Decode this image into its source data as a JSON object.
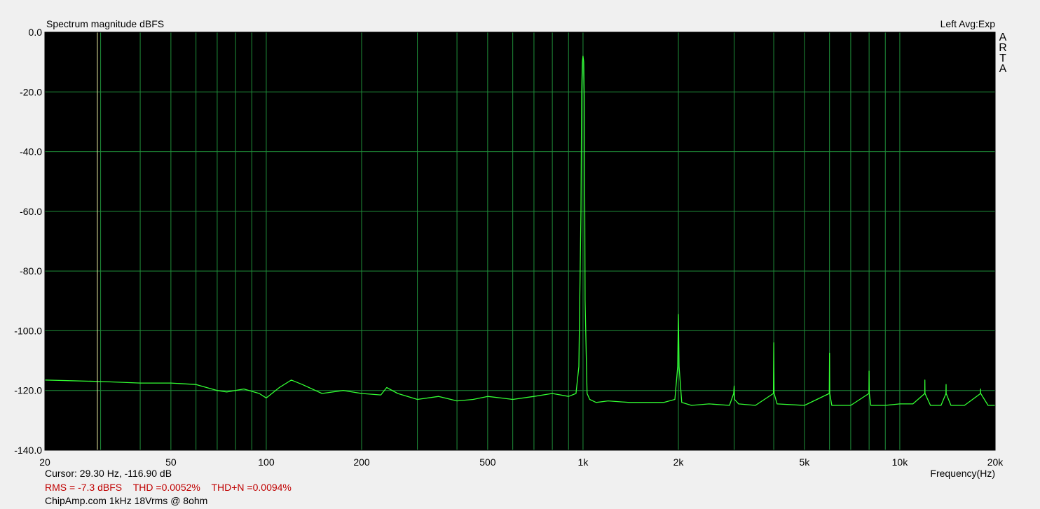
{
  "header": {
    "title": "Spectrum magnitude dBFS",
    "right_info": "Left  Avg:Exp",
    "brand_letters": [
      "A",
      "R",
      "T",
      "A"
    ]
  },
  "footer": {
    "cursor": "Cursor: 29.30 Hz, -116.90 dB",
    "xlabel": "Frequency(Hz)",
    "rms": "RMS =   -7.3 dBFS",
    "thd": "THD =0.0052%",
    "thdn": "THD+N =0.0094%",
    "caption": "ChipAmp.com 1kHz 18Vrms @ 8ohm"
  },
  "colors": {
    "plot_background": "#000000",
    "grid": "#1f8f3a",
    "trace": "#33ff33",
    "cursor": "#e8e8a0",
    "stats_text": "#c00000"
  },
  "chart_data": {
    "type": "line",
    "title": "Spectrum magnitude dBFS",
    "xlabel": "Frequency(Hz)",
    "ylabel": "",
    "x_scale": "log",
    "xlim": [
      20,
      20000
    ],
    "ylim": [
      -140,
      0
    ],
    "x_ticks": [
      20,
      50,
      100,
      200,
      500,
      1000,
      2000,
      5000,
      10000,
      20000
    ],
    "x_tick_labels": [
      "20",
      "50",
      "100",
      "200",
      "500",
      "1k",
      "2k",
      "5k",
      "10k",
      "20k"
    ],
    "y_ticks": [
      0,
      -20,
      -40,
      -60,
      -80,
      -100,
      -120,
      -140
    ],
    "y_tick_labels": [
      "0.0",
      "-20.0",
      "-40.0",
      "-60.0",
      "-80.0",
      "-100.0",
      "-120.0",
      "-140.0"
    ],
    "grid": true,
    "cursor_x": 29.3,
    "series": [
      {
        "color": "#33ff33",
        "x": [
          20,
          30,
          40,
          50,
          60,
          70,
          75,
          85,
          95,
          100,
          110,
          120,
          130,
          150,
          175,
          200,
          230,
          240,
          260,
          300,
          350,
          400,
          450,
          500,
          550,
          600,
          700,
          800,
          900,
          950,
          970,
          985,
          990,
          995,
          1000,
          1005,
          1010,
          1015,
          1030,
          1050,
          1100,
          1200,
          1400,
          1600,
          1800,
          1950,
          1990,
          2000,
          2010,
          2050,
          2200,
          2500,
          2900,
          2990,
          3000,
          3010,
          3100,
          3500,
          3990,
          4000,
          4010,
          4100,
          5000,
          5990,
          6000,
          6010,
          6100,
          7000,
          7990,
          8000,
          8010,
          8100,
          9000,
          10000,
          11000,
          11990,
          12000,
          12010,
          12500,
          13500,
          13990,
          14000,
          14010,
          14500,
          16000,
          17990,
          18000,
          18010,
          19000,
          20000
        ],
        "y": [
          -116.5,
          -117,
          -117.5,
          -117.5,
          -118,
          -120,
          -120.5,
          -119.5,
          -121,
          -122.5,
          -119,
          -116.5,
          -118,
          -121,
          -120,
          -121,
          -121.5,
          -119,
          -121,
          -123,
          -122,
          -123.5,
          -123,
          -122,
          -122.5,
          -123,
          -122,
          -121,
          -122,
          -121,
          -112,
          -60,
          -20,
          -10,
          -8,
          -10,
          -25,
          -90,
          -121,
          -123,
          -124,
          -123.5,
          -124,
          -124,
          -124,
          -123,
          -112,
          -94.5,
          -112,
          -124,
          -125,
          -124.5,
          -125,
          -121,
          -118.5,
          -123,
          -124.5,
          -125,
          -121,
          -104,
          -121,
          -124.5,
          -125,
          -121,
          -107.5,
          -121,
          -125,
          -125,
          -121,
          -113.5,
          -121,
          -125,
          -125,
          -124.5,
          -124.5,
          -121,
          -116.5,
          -121,
          -125,
          -125,
          -121,
          -118,
          -121,
          -125,
          -125,
          -121,
          -119.5,
          -121,
          -125,
          -125
        ]
      }
    ]
  }
}
